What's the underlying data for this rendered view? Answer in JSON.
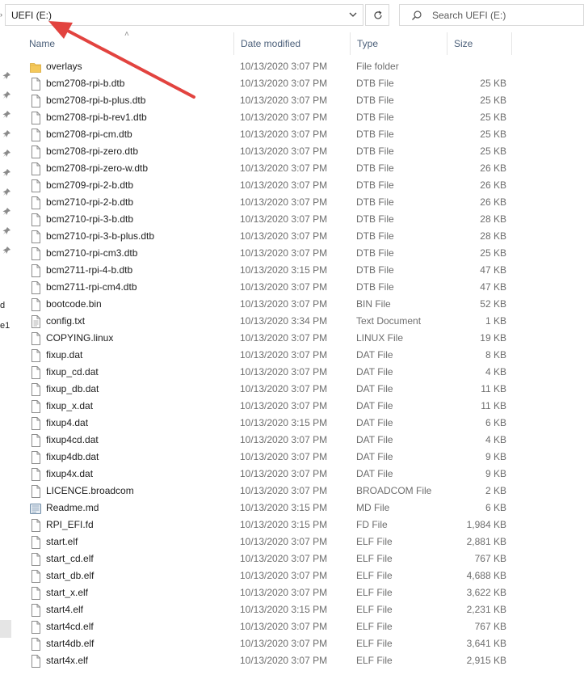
{
  "address": {
    "path": "UEFI (E:)"
  },
  "search": {
    "placeholder": "Search UEFI (E:)"
  },
  "columns": {
    "name": "Name",
    "date": "Date modified",
    "type": "Type",
    "size": "Size"
  },
  "nav": {
    "partial_1": "d",
    "partial_2": "e1"
  },
  "colors": {
    "annotation_arrow": "#e2433f",
    "header_text": "#4c607a",
    "folder": "#f4c85a"
  },
  "files": [
    {
      "name": "overlays",
      "date": "10/13/2020 3:07 PM",
      "type": "File folder",
      "size": "",
      "icon": "folder-icon"
    },
    {
      "name": "bcm2708-rpi-b.dtb",
      "date": "10/13/2020 3:07 PM",
      "type": "DTB File",
      "size": "25 KB",
      "icon": "file-icon"
    },
    {
      "name": "bcm2708-rpi-b-plus.dtb",
      "date": "10/13/2020 3:07 PM",
      "type": "DTB File",
      "size": "25 KB",
      "icon": "file-icon"
    },
    {
      "name": "bcm2708-rpi-b-rev1.dtb",
      "date": "10/13/2020 3:07 PM",
      "type": "DTB File",
      "size": "25 KB",
      "icon": "file-icon"
    },
    {
      "name": "bcm2708-rpi-cm.dtb",
      "date": "10/13/2020 3:07 PM",
      "type": "DTB File",
      "size": "25 KB",
      "icon": "file-icon"
    },
    {
      "name": "bcm2708-rpi-zero.dtb",
      "date": "10/13/2020 3:07 PM",
      "type": "DTB File",
      "size": "25 KB",
      "icon": "file-icon"
    },
    {
      "name": "bcm2708-rpi-zero-w.dtb",
      "date": "10/13/2020 3:07 PM",
      "type": "DTB File",
      "size": "26 KB",
      "icon": "file-icon"
    },
    {
      "name": "bcm2709-rpi-2-b.dtb",
      "date": "10/13/2020 3:07 PM",
      "type": "DTB File",
      "size": "26 KB",
      "icon": "file-icon"
    },
    {
      "name": "bcm2710-rpi-2-b.dtb",
      "date": "10/13/2020 3:07 PM",
      "type": "DTB File",
      "size": "26 KB",
      "icon": "file-icon"
    },
    {
      "name": "bcm2710-rpi-3-b.dtb",
      "date": "10/13/2020 3:07 PM",
      "type": "DTB File",
      "size": "28 KB",
      "icon": "file-icon"
    },
    {
      "name": "bcm2710-rpi-3-b-plus.dtb",
      "date": "10/13/2020 3:07 PM",
      "type": "DTB File",
      "size": "28 KB",
      "icon": "file-icon"
    },
    {
      "name": "bcm2710-rpi-cm3.dtb",
      "date": "10/13/2020 3:07 PM",
      "type": "DTB File",
      "size": "25 KB",
      "icon": "file-icon"
    },
    {
      "name": "bcm2711-rpi-4-b.dtb",
      "date": "10/13/2020 3:15 PM",
      "type": "DTB File",
      "size": "47 KB",
      "icon": "file-icon"
    },
    {
      "name": "bcm2711-rpi-cm4.dtb",
      "date": "10/13/2020 3:07 PM",
      "type": "DTB File",
      "size": "47 KB",
      "icon": "file-icon"
    },
    {
      "name": "bootcode.bin",
      "date": "10/13/2020 3:07 PM",
      "type": "BIN File",
      "size": "52 KB",
      "icon": "file-icon"
    },
    {
      "name": "config.txt",
      "date": "10/13/2020 3:34 PM",
      "type": "Text Document",
      "size": "1 KB",
      "icon": "text-file-icon"
    },
    {
      "name": "COPYING.linux",
      "date": "10/13/2020 3:07 PM",
      "type": "LINUX File",
      "size": "19 KB",
      "icon": "file-icon"
    },
    {
      "name": "fixup.dat",
      "date": "10/13/2020 3:07 PM",
      "type": "DAT File",
      "size": "8 KB",
      "icon": "file-icon"
    },
    {
      "name": "fixup_cd.dat",
      "date": "10/13/2020 3:07 PM",
      "type": "DAT File",
      "size": "4 KB",
      "icon": "file-icon"
    },
    {
      "name": "fixup_db.dat",
      "date": "10/13/2020 3:07 PM",
      "type": "DAT File",
      "size": "11 KB",
      "icon": "file-icon"
    },
    {
      "name": "fixup_x.dat",
      "date": "10/13/2020 3:07 PM",
      "type": "DAT File",
      "size": "11 KB",
      "icon": "file-icon"
    },
    {
      "name": "fixup4.dat",
      "date": "10/13/2020 3:15 PM",
      "type": "DAT File",
      "size": "6 KB",
      "icon": "file-icon"
    },
    {
      "name": "fixup4cd.dat",
      "date": "10/13/2020 3:07 PM",
      "type": "DAT File",
      "size": "4 KB",
      "icon": "file-icon"
    },
    {
      "name": "fixup4db.dat",
      "date": "10/13/2020 3:07 PM",
      "type": "DAT File",
      "size": "9 KB",
      "icon": "file-icon"
    },
    {
      "name": "fixup4x.dat",
      "date": "10/13/2020 3:07 PM",
      "type": "DAT File",
      "size": "9 KB",
      "icon": "file-icon"
    },
    {
      "name": "LICENCE.broadcom",
      "date": "10/13/2020 3:07 PM",
      "type": "BROADCOM File",
      "size": "2 KB",
      "icon": "file-icon"
    },
    {
      "name": "Readme.md",
      "date": "10/13/2020 3:15 PM",
      "type": "MD File",
      "size": "6 KB",
      "icon": "markdown-file-icon"
    },
    {
      "name": "RPI_EFI.fd",
      "date": "10/13/2020 3:15 PM",
      "type": "FD File",
      "size": "1,984 KB",
      "icon": "file-icon"
    },
    {
      "name": "start.elf",
      "date": "10/13/2020 3:07 PM",
      "type": "ELF File",
      "size": "2,881 KB",
      "icon": "file-icon"
    },
    {
      "name": "start_cd.elf",
      "date": "10/13/2020 3:07 PM",
      "type": "ELF File",
      "size": "767 KB",
      "icon": "file-icon"
    },
    {
      "name": "start_db.elf",
      "date": "10/13/2020 3:07 PM",
      "type": "ELF File",
      "size": "4,688 KB",
      "icon": "file-icon"
    },
    {
      "name": "start_x.elf",
      "date": "10/13/2020 3:07 PM",
      "type": "ELF File",
      "size": "3,622 KB",
      "icon": "file-icon"
    },
    {
      "name": "start4.elf",
      "date": "10/13/2020 3:15 PM",
      "type": "ELF File",
      "size": "2,231 KB",
      "icon": "file-icon"
    },
    {
      "name": "start4cd.elf",
      "date": "10/13/2020 3:07 PM",
      "type": "ELF File",
      "size": "767 KB",
      "icon": "file-icon"
    },
    {
      "name": "start4db.elf",
      "date": "10/13/2020 3:07 PM",
      "type": "ELF File",
      "size": "3,641 KB",
      "icon": "file-icon"
    },
    {
      "name": "start4x.elf",
      "date": "10/13/2020 3:07 PM",
      "type": "ELF File",
      "size": "2,915 KB",
      "icon": "file-icon"
    }
  ]
}
